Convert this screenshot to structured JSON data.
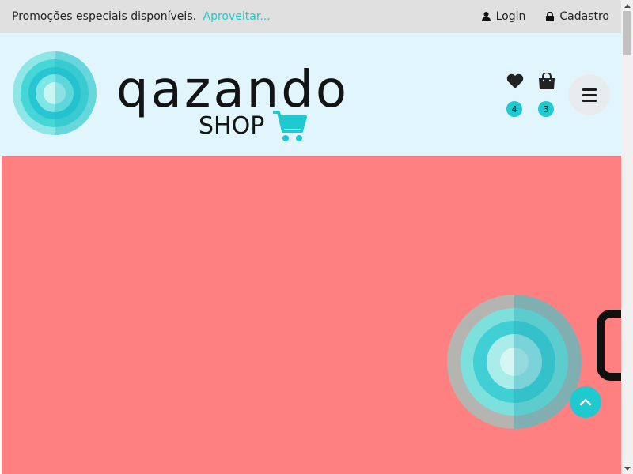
{
  "topbar": {
    "promo_text": "Promoções especiais disponíveis.",
    "promo_link": "Aproveitar...",
    "login_label": "Login",
    "register_label": "Cadastro"
  },
  "header": {
    "logo_word": "qazando",
    "logo_sub": "SHOP",
    "wishlist_count": "4",
    "cart_count": "3",
    "wishlist_icon": "heart-icon",
    "cart_icon": "shopping-bag-icon",
    "menu_icon": "hamburger-icon"
  },
  "colors": {
    "accent": "#1ec9d0",
    "topbar_bg": "#e0e0e0",
    "header_bg": "#e1f6fc",
    "hero_bg": "#ff8080"
  }
}
